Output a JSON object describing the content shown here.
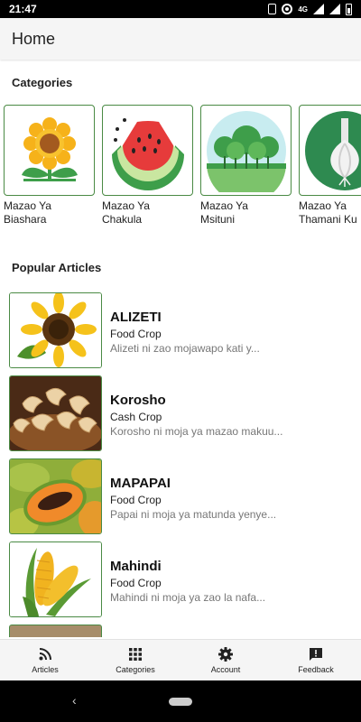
{
  "status_bar": {
    "time": "21:47",
    "network": "4G"
  },
  "app_bar": {
    "title": "Home"
  },
  "sections": {
    "categories_title": "Categories",
    "popular_title": "Popular Articles"
  },
  "categories": [
    {
      "label": "Mazao Ya\nBiashara",
      "icon": "sunflower-icon"
    },
    {
      "label": "Mazao Ya\nChakula",
      "icon": "watermelon-icon"
    },
    {
      "label": "Mazao Ya\nMsituni",
      "icon": "forest-icon"
    },
    {
      "label": "Mazao Ya\nThamani Ku",
      "icon": "garlic-icon"
    }
  ],
  "articles": [
    {
      "title": "ALIZETI",
      "category": "Food Crop",
      "description": "Alizeti ni zao mojawapo kati y..."
    },
    {
      "title": "Korosho",
      "category": "Cash Crop",
      "description": "Korosho ni moja ya mazao makuu..."
    },
    {
      "title": "MAPAPAI",
      "category": "Food Crop",
      "description": "Papai ni moja ya matunda yenye..."
    },
    {
      "title": "Mahindi",
      "category": "Food Crop",
      "description": "Mahindi ni moja ya zao la nafa..."
    }
  ],
  "bottom_nav": [
    {
      "label": "Articles",
      "icon": "rss-icon"
    },
    {
      "label": "Categories",
      "icon": "grid-icon"
    },
    {
      "label": "Account",
      "icon": "gear-icon"
    },
    {
      "label": "Feedback",
      "icon": "feedback-icon"
    }
  ],
  "colors": {
    "thumb_border": "#4a8a44",
    "app_bar_bg": "#f5f5f5",
    "status_bar_bg": "#000000"
  }
}
